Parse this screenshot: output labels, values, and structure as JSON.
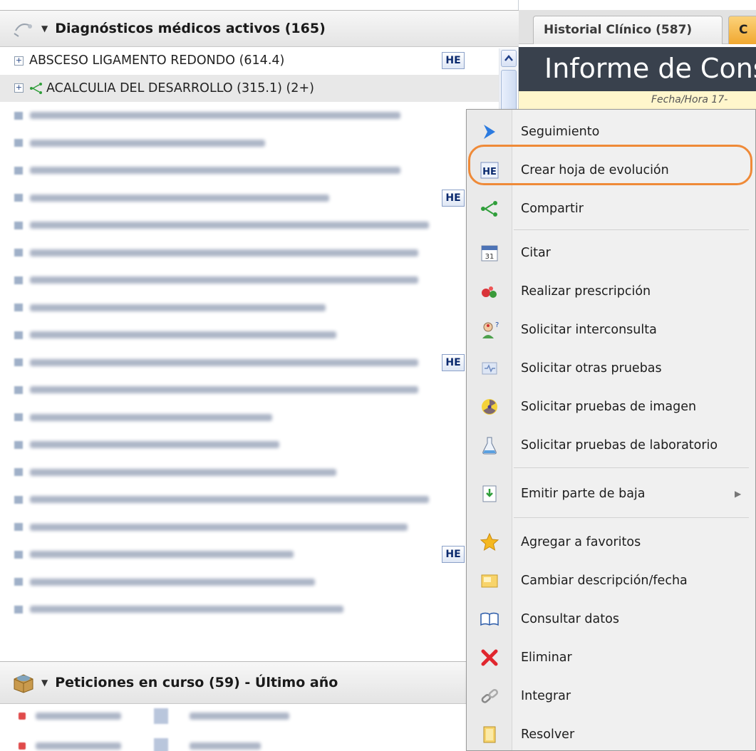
{
  "diagnostics": {
    "header": "Diagnósticos médicos activos  (165)",
    "rows": [
      {
        "label": "ABSCESO LIGAMENTO REDONDO (614.4)",
        "he": "HE"
      },
      {
        "label": "ACALCULIA DEL DESARROLLO (315.1) (2+)"
      }
    ]
  },
  "requests": {
    "header": "Peticiones en curso (59) - Último año"
  },
  "tabs": {
    "historial": "Historial Clínico (587)",
    "other": "C"
  },
  "report": {
    "title": "Informe de Consu",
    "fecha_label": "Fecha/Hora  17-"
  },
  "he_badge": "HE",
  "context_menu": {
    "items": [
      {
        "label": "Seguimiento",
        "icon": "arrow-right-icon"
      },
      {
        "label": "Crear hoja de evolución",
        "icon": "he-icon",
        "highlighted": true
      },
      {
        "label": "Compartir",
        "icon": "share-icon"
      },
      {
        "label": "Citar",
        "icon": "calendar-icon"
      },
      {
        "label": "Realizar prescripción",
        "icon": "pills-icon"
      },
      {
        "label": "Solicitar interconsulta",
        "icon": "doctor-icon"
      },
      {
        "label": "Solicitar otras pruebas",
        "icon": "tests-icon"
      },
      {
        "label": "Solicitar pruebas de imagen",
        "icon": "radiation-icon"
      },
      {
        "label": "Solicitar pruebas de laboratorio",
        "icon": "flask-icon"
      },
      {
        "label": "Emitir parte de baja",
        "icon": "sick-leave-icon",
        "submenu": true
      },
      {
        "label": "Agregar a favoritos",
        "icon": "star-icon"
      },
      {
        "label": "Cambiar descripción/fecha",
        "icon": "edit-icon"
      },
      {
        "label": "Consultar datos",
        "icon": "book-icon"
      },
      {
        "label": "Eliminar",
        "icon": "delete-icon"
      },
      {
        "label": "Integrar",
        "icon": "link-icon"
      },
      {
        "label": "Resolver",
        "icon": "resolve-icon"
      }
    ]
  },
  "colors": {
    "highlight_ring": "#ef8a38",
    "report_header_bg": "#39414d",
    "active_tab": "#f1a830"
  }
}
